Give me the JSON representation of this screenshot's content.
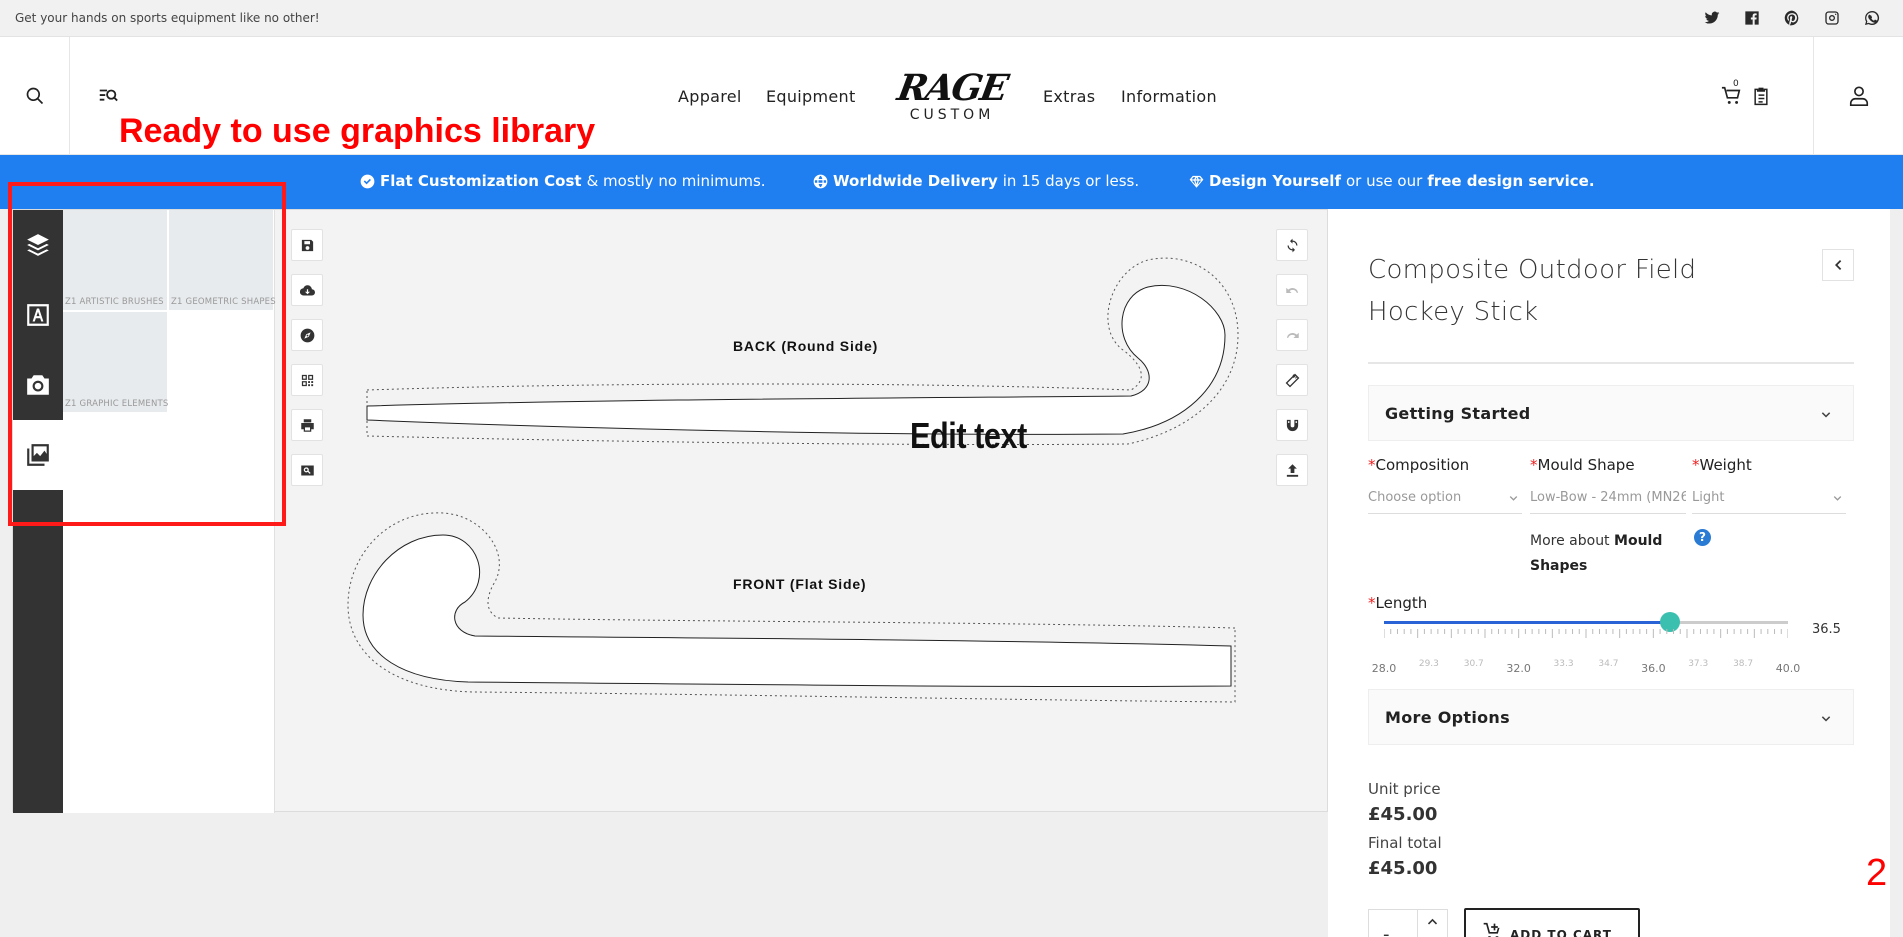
{
  "topbar": {
    "tagline": "Get your hands on sports equipment like no other!",
    "socials": [
      "twitter-icon",
      "facebook-icon",
      "pinterest-icon",
      "instagram-icon",
      "whatsapp-icon"
    ]
  },
  "header": {
    "nav": [
      "Apparel",
      "Equipment",
      "Extras",
      "Information"
    ],
    "logo_word": "RAGE",
    "logo_sub": "CUSTOM",
    "cart_count": "0"
  },
  "annotation": {
    "title": "Ready to use graphics library",
    "number": "2",
    "color": "#ff0000"
  },
  "promo": {
    "item1_bold": "Flat Customization Cost",
    "item1_rest": "& mostly no minimums.",
    "item2_bold": "Worldwide Delivery",
    "item2_rest": "in 15 days or less.",
    "item3_bold": "Design Yourself",
    "item3_mid": "or use our",
    "item3_bold2": "free design service.",
    "color": "#1f7ef0"
  },
  "library": {
    "tiles": [
      "Z1 ARTISTIC BRUSHES",
      "Z1 GEOMETRIC SHAPES",
      "Z1 GRAPHIC ELEMENTS"
    ]
  },
  "canvas": {
    "back_label": "BACK (Round Side)",
    "front_label": "FRONT (Flat Side)",
    "edit_text": "Edit text"
  },
  "product": {
    "title": "Composite Outdoor Field Hockey Stick",
    "getting_started": "Getting Started",
    "composition_label": "Composition",
    "composition_value": "Choose option",
    "mould_label": "Mould Shape",
    "mould_value": "Low-Bow - 24mm (MN26",
    "weight_label": "Weight",
    "weight_value": "Light",
    "more_about_prefix": "More about",
    "more_about_bold": "Mould Shapes",
    "help": "?",
    "length_label": "Length",
    "length_value": "36.5",
    "length_min": 28.0,
    "length_max": 40.0,
    "slider_labels": [
      "28.0",
      "29.3",
      "30.7",
      "32.0",
      "33.3",
      "34.7",
      "36.0",
      "37.3",
      "38.7",
      "40.0"
    ],
    "more_options": "More Options",
    "unit_price_label": "Unit price",
    "unit_price": "£45.00",
    "final_total_label": "Final total",
    "final_total": "£45.00",
    "qty_minus": "-",
    "add_to_cart": "ADD TO CART",
    "accent": "#3bbfae",
    "required_mark": "*"
  }
}
